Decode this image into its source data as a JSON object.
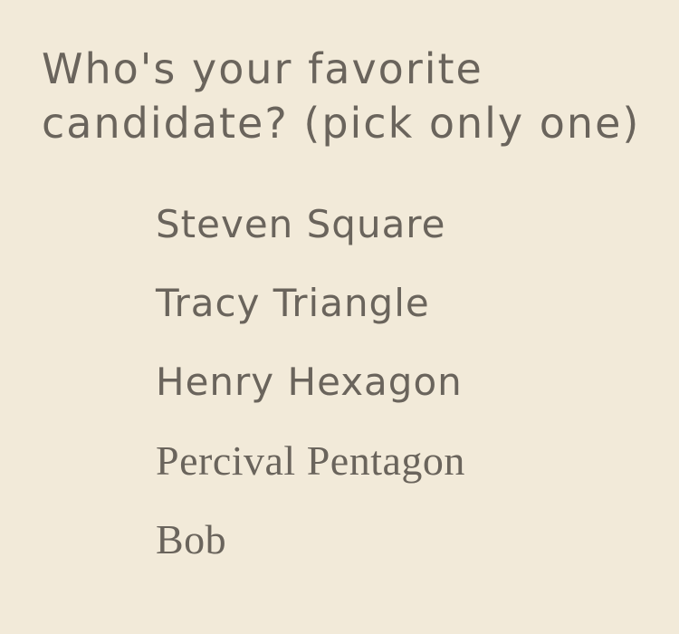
{
  "question": {
    "line1": "Who's your favorite",
    "line2": "candidate? (pick only one)"
  },
  "options": [
    {
      "label": "Steven Square"
    },
    {
      "label": "Tracy Triangle"
    },
    {
      "label": "Henry Hexagon"
    },
    {
      "label": "Percival Pentagon"
    },
    {
      "label": "Bob"
    }
  ],
  "colors": {
    "background": "#f2ead9",
    "text": "#6a645c"
  }
}
